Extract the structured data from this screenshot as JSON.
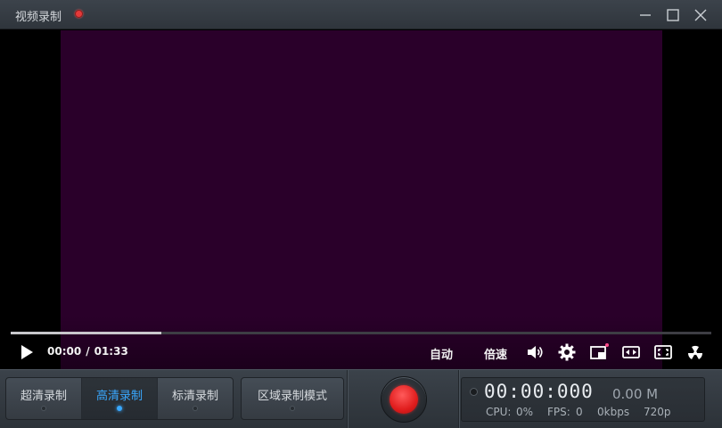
{
  "window": {
    "title": "视频录制",
    "controls": [
      "minimize-icon",
      "maximize-icon",
      "close-icon"
    ]
  },
  "player": {
    "progress_fraction": 0.215,
    "current_time": "00:00",
    "separator": "/",
    "total_time": "01:33",
    "auto_label": "自动",
    "speed_label": "倍速",
    "icons": [
      "play-icon",
      "volume-icon",
      "settings-icon",
      "pip-icon",
      "widescreen-icon",
      "fullscreen-icon",
      "radiation-icon"
    ]
  },
  "modes": {
    "items": [
      {
        "label": "超清录制",
        "active": false
      },
      {
        "label": "高清录制",
        "active": true
      },
      {
        "label": "标清录制",
        "active": false
      }
    ],
    "region_label": "区域录制模式"
  },
  "status": {
    "timer": "00:00:000",
    "size": "0.00 M",
    "cpu_label": "CPU:",
    "cpu_value": "0%",
    "fps_label": "FPS:",
    "fps_value": "0",
    "bitrate": "0kbps",
    "resolution": "720p"
  },
  "colors": {
    "accent": "#39a8ff",
    "record": "#e01d1d",
    "video_bg": "#2a002a"
  }
}
